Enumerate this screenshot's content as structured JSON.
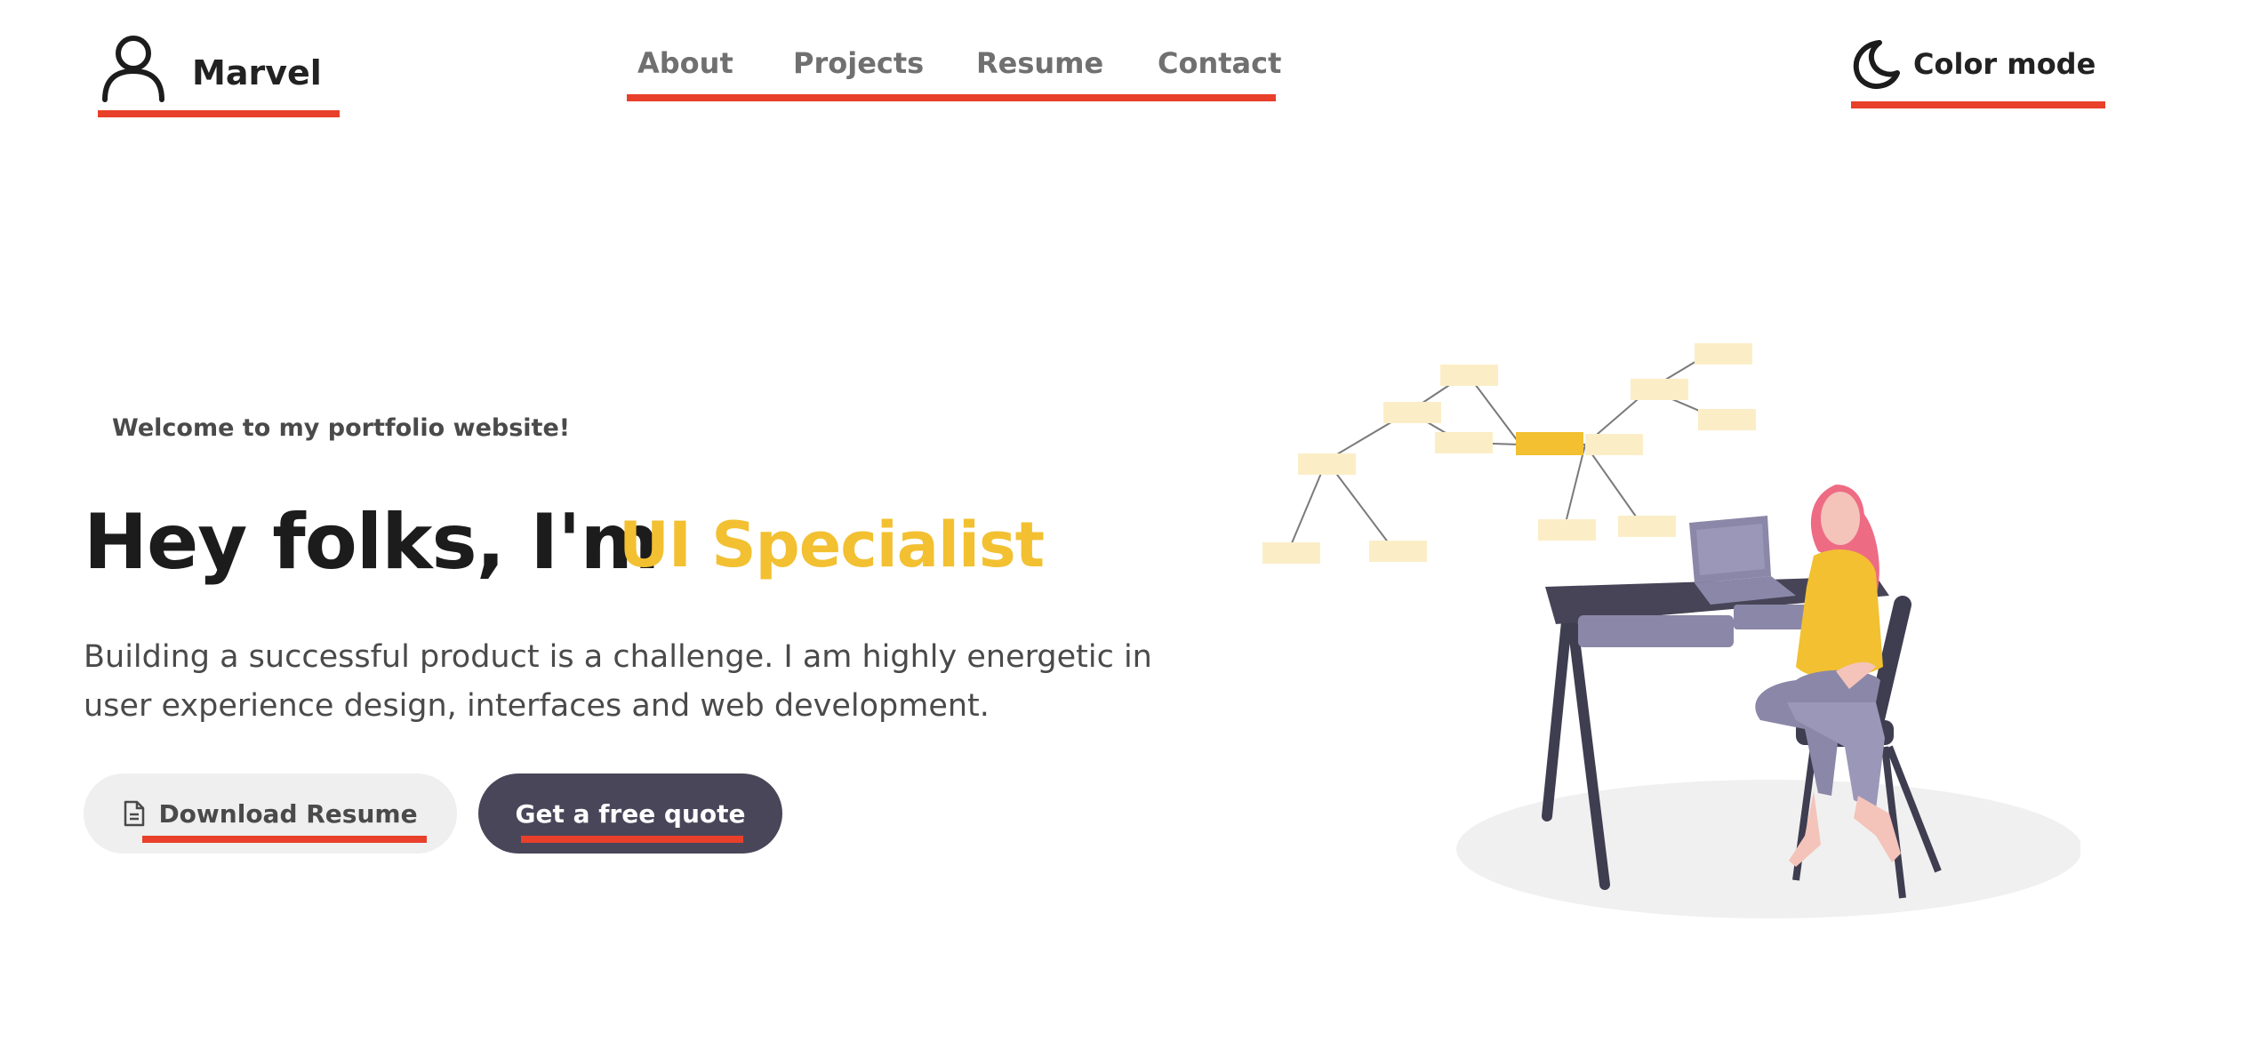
{
  "header": {
    "logo_text": "Marvel",
    "nav": [
      "About",
      "Projects",
      "Resume",
      "Contact"
    ],
    "color_mode_label": "Color mode"
  },
  "hero": {
    "welcome": "Welcome to my portfolio website!",
    "title": "Hey folks, I'm",
    "accent": "UI Specialist",
    "description": "Building a successful product is a challenge. I am highly energetic in user experience design, interfaces and web development."
  },
  "buttons": {
    "download_resume": "Download Resume",
    "free_quote": "Get a free quote"
  },
  "colors": {
    "accent_yellow": "#f2c031",
    "underline_red": "#e8402a",
    "dark_button": "#4a4659",
    "light_button": "#efefef"
  },
  "icons": [
    "user-icon",
    "moon-icon",
    "document-icon"
  ]
}
